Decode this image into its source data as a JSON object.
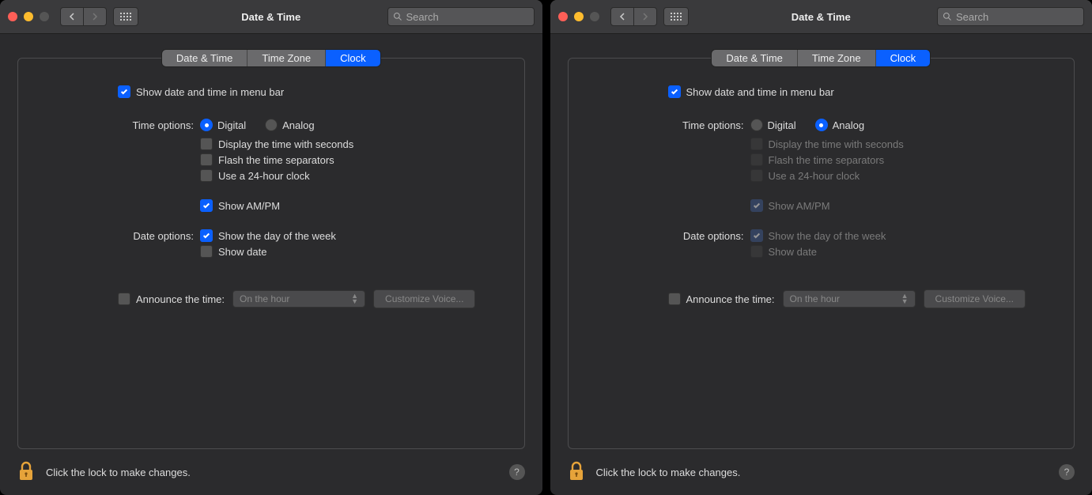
{
  "left": {
    "title": "Date & Time",
    "search_placeholder": "Search",
    "tabs": [
      "Date & Time",
      "Time Zone",
      "Clock"
    ],
    "show_in_menubar": "Show date and time in menu bar",
    "time_options_label": "Time options:",
    "digital": "Digital",
    "analog": "Analog",
    "seconds": "Display the time with seconds",
    "flash": "Flash the time separators",
    "use24": "Use a 24-hour clock",
    "ampm": "Show AM/PM",
    "date_options_label": "Date options:",
    "dow": "Show the day of the week",
    "show_date": "Show date",
    "announce": "Announce the time:",
    "interval": "On the hour",
    "customize": "Customize Voice...",
    "lock_text": "Click the lock to make changes.",
    "help": "?"
  },
  "right": {
    "title": "Date & Time",
    "search_placeholder": "Search",
    "tabs": [
      "Date & Time",
      "Time Zone",
      "Clock"
    ],
    "show_in_menubar": "Show date and time in menu bar",
    "time_options_label": "Time options:",
    "digital": "Digital",
    "analog": "Analog",
    "seconds": "Display the time with seconds",
    "flash": "Flash the time separators",
    "use24": "Use a 24-hour clock",
    "ampm": "Show AM/PM",
    "date_options_label": "Date options:",
    "dow": "Show the day of the week",
    "show_date": "Show date",
    "announce": "Announce the time:",
    "interval": "On the hour",
    "customize": "Customize Voice...",
    "lock_text": "Click the lock to make changes.",
    "help": "?"
  }
}
